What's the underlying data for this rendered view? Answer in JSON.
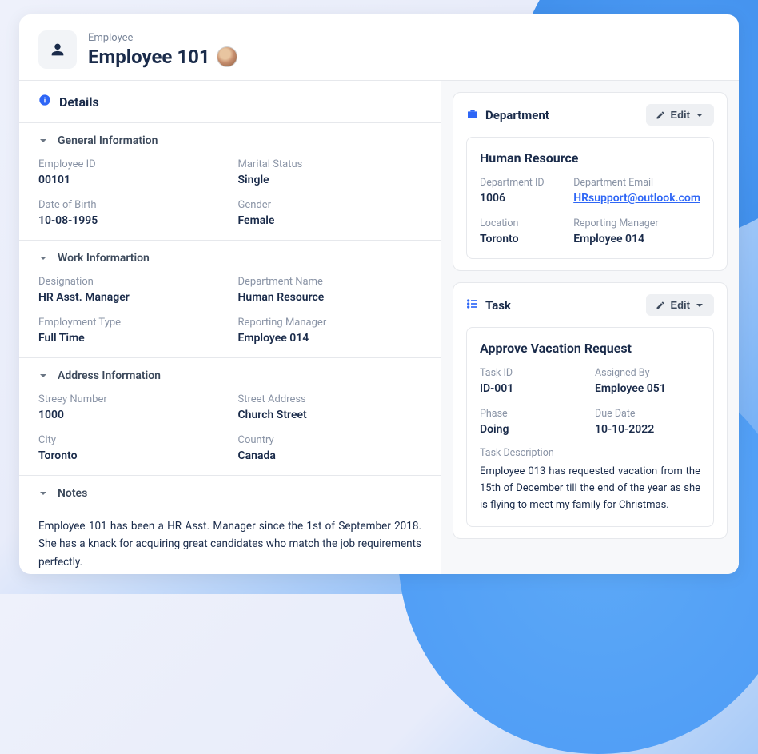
{
  "header": {
    "breadcrumb": "Employee",
    "title": "Employee 101"
  },
  "details": {
    "title": "Details",
    "sections": {
      "general": {
        "title": "General Information",
        "fields": {
          "employee_id_lbl": "Employee ID",
          "employee_id_val": "00101",
          "marital_lbl": "Marital Status",
          "marital_val": "Single",
          "dob_lbl": "Date of Birth",
          "dob_val": "10-08-1995",
          "gender_lbl": "Gender",
          "gender_val": "Female"
        }
      },
      "work": {
        "title": "Work Informartion",
        "fields": {
          "designation_lbl": "Designation",
          "designation_val": "HR Asst. Manager",
          "dept_lbl": "Department Name",
          "dept_val": "Human Resource",
          "emptype_lbl": "Employment Type",
          "emptype_val": "Full Time",
          "mgr_lbl": "Reporting Manager",
          "mgr_val": "Employee 014"
        }
      },
      "address": {
        "title": "Address Information",
        "fields": {
          "stnum_lbl": "Streey Number",
          "stnum_val": "1000",
          "staddr_lbl": "Street Address",
          "staddr_val": "Church Street",
          "city_lbl": "City",
          "city_val": "Toronto",
          "country_lbl": "Country",
          "country_val": "Canada"
        }
      },
      "notes": {
        "title": "Notes",
        "body": "Employee 101 has been a HR Asst. Manager since the 1st of September 2018. She has a knack for acquiring great candidates who match the job requirements perfectly."
      }
    }
  },
  "department": {
    "title": "Department",
    "edit": "Edit",
    "name": "Human Resource",
    "fields": {
      "id_lbl": "Department ID",
      "id_val": "1006",
      "email_lbl": "Department Email",
      "email_val": "HRsupport@outlook.com",
      "loc_lbl": "Location",
      "loc_val": "Toronto",
      "mgr_lbl": "Reporting Manager",
      "mgr_val": "Employee 014"
    }
  },
  "task": {
    "title": "Task",
    "edit": "Edit",
    "name": "Approve Vacation Request",
    "fields": {
      "id_lbl": "Task ID",
      "id_val": "ID-001",
      "assigned_lbl": "Assigned By",
      "assigned_val": "Employee 051",
      "phase_lbl": "Phase",
      "phase_val": "Doing",
      "due_lbl": "Due Date",
      "due_val": "10-10-2022"
    },
    "desc_lbl": "Task Description",
    "desc": "Employee 013 has requested vacation from the 15th of December till the end of the year as she is flying to meet my family for Christmas."
  }
}
